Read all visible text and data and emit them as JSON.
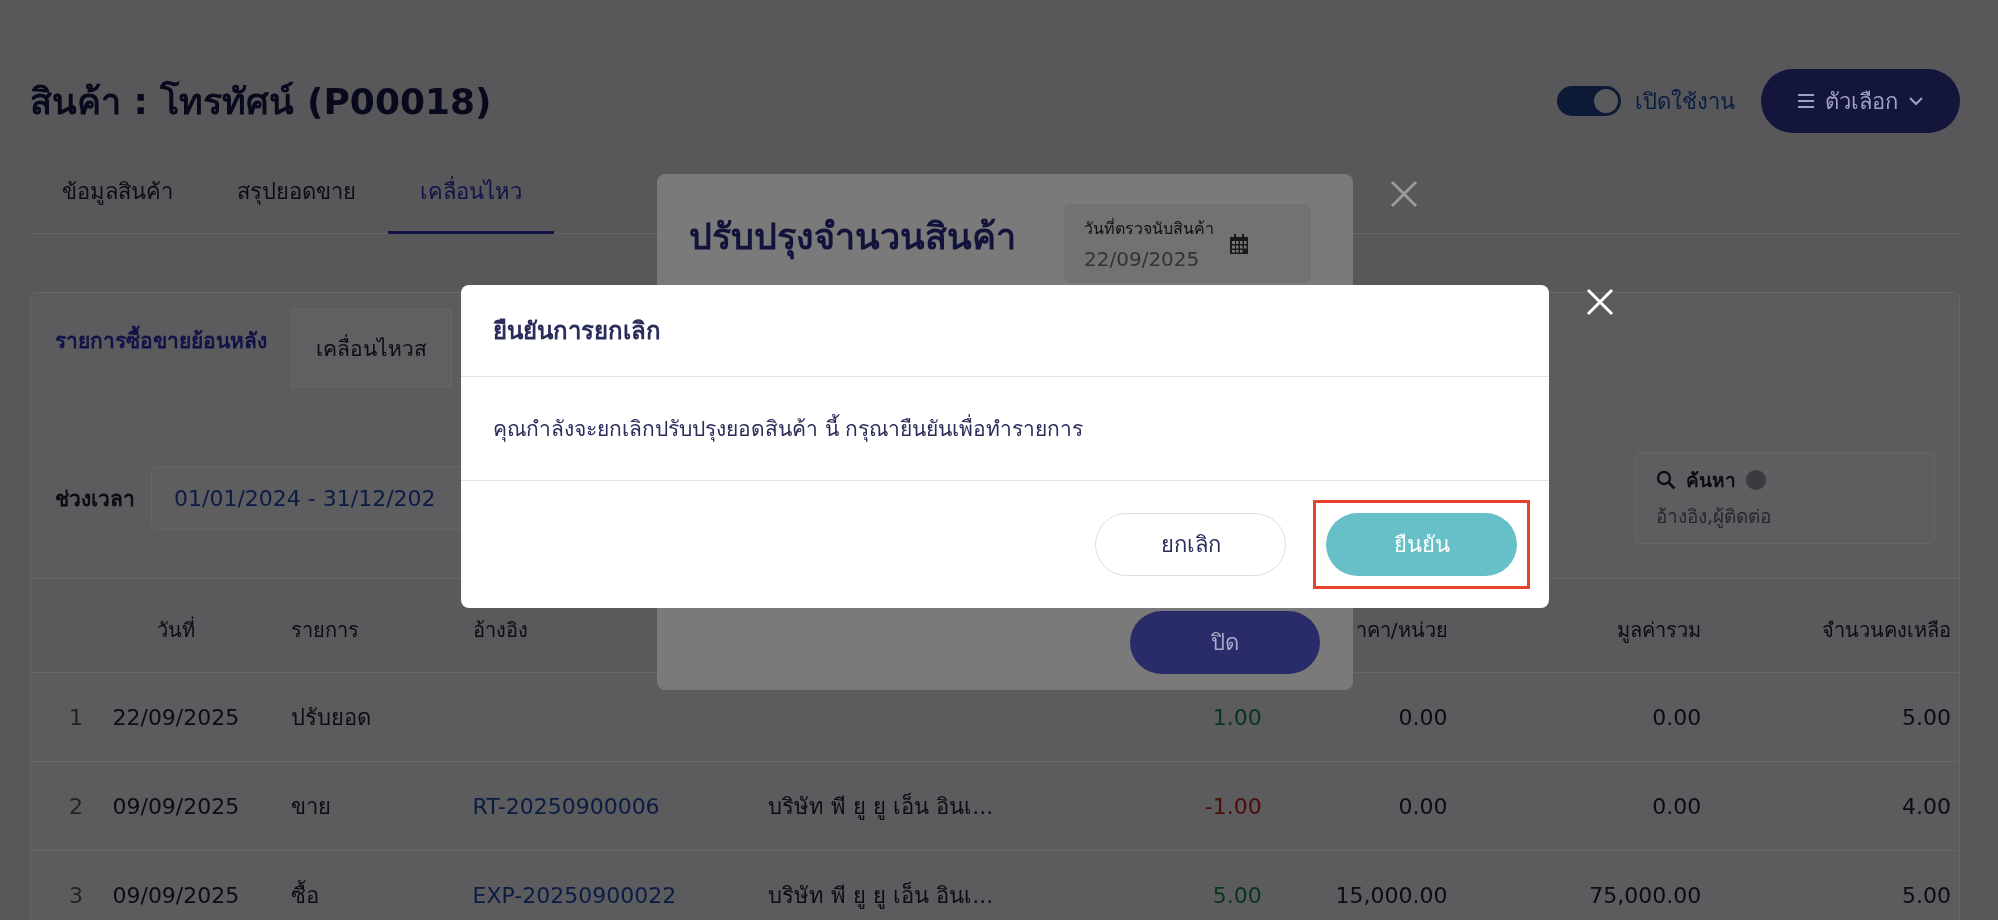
{
  "page": {
    "title": "สินค้า : โทรทัศน์ (P00018)",
    "status_toggle": {
      "label": "เปิดใช้งาน",
      "on": true
    },
    "options_button": {
      "label": "ตัวเลือก"
    }
  },
  "tabs": [
    {
      "label": "ข้อมูลสินค้า",
      "selected": false
    },
    {
      "label": "สรุปยอดขาย",
      "selected": false
    },
    {
      "label": "เคลื่อนไหว",
      "selected": true
    }
  ],
  "subtabs": [
    {
      "label": "รายการซื้อขายย้อนหลัง",
      "selected": true
    },
    {
      "label": "เคลื่อนไหวส",
      "selected": false
    }
  ],
  "filters": {
    "period_label": "ช่วงเวลา",
    "period_value": "01/01/2024 - 31/12/202",
    "search_label": "ค้นหา",
    "search_placeholder": "อ้างอิง,ผู้ติดต่อ"
  },
  "table": {
    "columns": {
      "date": "วันที่",
      "item": "รายการ",
      "ref": "อ้างอิง",
      "unit_price": "าคา/หน่วย",
      "total": "มูลค่ารวม",
      "balance": "จำนวนคงเหลือ"
    },
    "rows": [
      {
        "no": "1",
        "date": "22/09/2025",
        "item": "ปรับยอด",
        "qty": "1.00",
        "negative": false,
        "unit_price": "0.00",
        "total": "0.00",
        "balance": "5.00"
      },
      {
        "no": "2",
        "date": "09/09/2025",
        "item": "ขาย",
        "ref": "RT-20250900006",
        "contact": "บริษัท พี ยู ยู เอ็น อินเ...",
        "qty": "-1.00",
        "negative": true,
        "unit_price": "0.00",
        "total": "0.00",
        "balance": "4.00"
      },
      {
        "no": "3",
        "date": "09/09/2025",
        "item": "ซื้อ",
        "ref": "EXP-20250900022",
        "contact": "บริษัท พี ยู ยู เอ็น อินเ...",
        "qty": "5.00",
        "negative": false,
        "unit_price": "15,000.00",
        "total": "75,000.00",
        "balance": "5.00"
      }
    ]
  },
  "adjust_modal": {
    "title": "ปรับปรุงจำนวนสินค้า",
    "count_date_label": "วันที่ตรวจนับสินค้า",
    "count_date": "22/09/2025",
    "close_button": "ปิด"
  },
  "confirm_dialog": {
    "title": "ยืนยันการยกเลิก",
    "message": "คุณกำลังจะยกเลิกปรับปรุงยอดสินค้า นี้ กรุณายืนยันเพื่อทำรายการ",
    "buttons": [
      {
        "label": "ยกเลิก",
        "kind": "secondary",
        "highlighted": false
      },
      {
        "label": "ยืนยัน",
        "kind": "primary",
        "highlighted": true
      }
    ]
  }
}
